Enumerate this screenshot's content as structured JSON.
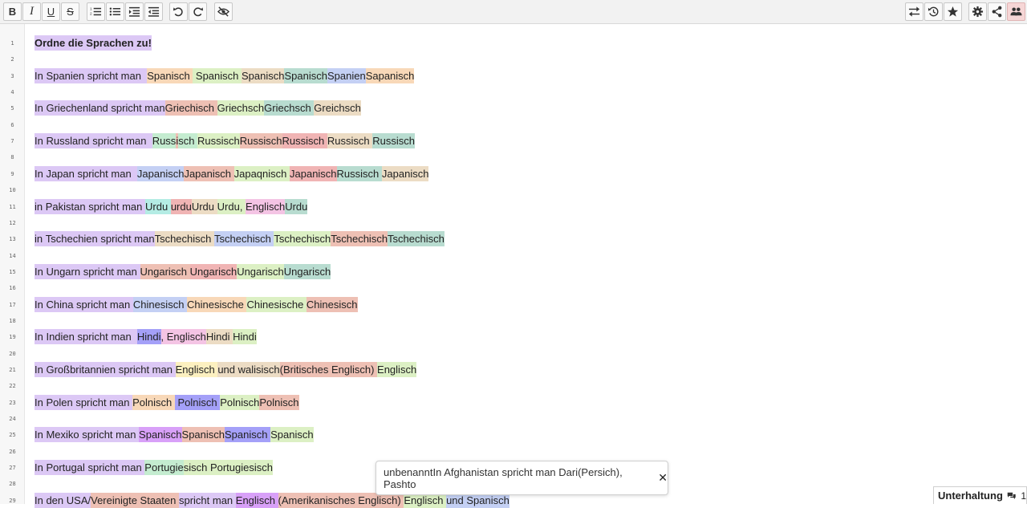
{
  "colors": {
    "lavender": "#dcc8f5",
    "peach": "#f8d8b8",
    "salmon": "#eec0b4",
    "lime": "#dcf0c4",
    "green": "#c4ecd0",
    "teal": "#b8dcd0",
    "cyan": "#b4ece4",
    "blue": "#c4d0f4",
    "rose": "#f0b4b4",
    "pink": "#f4c4e4",
    "tan": "#ecdcc4",
    "purple": "#bca4f8",
    "magenta": "#d8a0f8",
    "yellow": "#fcf0c0",
    "violet": "#a4a0f8"
  },
  "toolbar": {
    "format_buttons": [
      {
        "label": "B",
        "icon": "bold-icon"
      },
      {
        "label": "I",
        "icon": "italic-icon"
      },
      {
        "label": "U",
        "icon": "underline-icon"
      },
      {
        "label": "S",
        "icon": "strikethrough-icon"
      }
    ],
    "list_buttons": [
      "ordered-list-icon",
      "unordered-list-icon",
      "indent-icon",
      "outdent-icon"
    ],
    "history_buttons": [
      "undo-icon",
      "redo-icon"
    ],
    "visibility_button": "eye-off-icon",
    "right_buttons": [
      "import-export-icon",
      "history-icon",
      "star-icon",
      "settings-icon",
      "share-icon",
      "users-icon"
    ]
  },
  "gutter": {
    "numbers": [
      "1",
      "2",
      "3",
      "4",
      "5",
      "6",
      "7",
      "8",
      "9",
      "10",
      "11",
      "12",
      "13",
      "14",
      "15",
      "16",
      "17",
      "18",
      "19",
      "20",
      "21",
      "22",
      "23",
      "24",
      "25",
      "26",
      "27",
      "28",
      "29"
    ]
  },
  "editor": {
    "lines": [
      {
        "row": 1,
        "title": true,
        "segments": [
          {
            "t": "Ordne die Sprachen zu!",
            "c": "lavender"
          }
        ]
      },
      {
        "row": 3,
        "segments": [
          {
            "t": "In Spanien spricht man  ",
            "c": "lavender"
          },
          {
            "t": "Spanisch ",
            "c": "peach"
          },
          {
            "t": " Spanisch ",
            "c": "lime"
          },
          {
            "t": "Spanisch",
            "c": "tan"
          },
          {
            "t": "Spanisch",
            "c": "teal"
          },
          {
            "t": "Spanien",
            "c": "blue"
          },
          {
            "t": "Sapanisch",
            "c": "peach"
          }
        ]
      },
      {
        "row": 5,
        "segments": [
          {
            "t": "In Griechenland spricht man",
            "c": "lavender"
          },
          {
            "t": "Griechisch ",
            "c": "salmon"
          },
          {
            "t": "Griechsch",
            "c": "lime"
          },
          {
            "t": "Griechsch ",
            "c": "teal"
          },
          {
            "t": "Greichsch",
            "c": "tan"
          }
        ]
      },
      {
        "row": 7,
        "segments": [
          {
            "t": "In Russland spricht man  ",
            "c": "lavender"
          },
          {
            "t": "Russ",
            "c": "green"
          },
          {
            "t": "i",
            "c": "salmon"
          },
          {
            "t": "sch ",
            "c": "green"
          },
          {
            "t": "Russisch",
            "c": "lime"
          },
          {
            "t": "Russisch",
            "c": "salmon"
          },
          {
            "t": "Russisch ",
            "c": "rose"
          },
          {
            "t": "Russisch ",
            "c": "tan"
          },
          {
            "t": "Russisch",
            "c": "teal"
          }
        ]
      },
      {
        "row": 9,
        "segments": [
          {
            "t": "In Japan spricht man  ",
            "c": "lavender"
          },
          {
            "t": "Japanisch",
            "c": "blue"
          },
          {
            "t": "Japanisch ",
            "c": "salmon"
          },
          {
            "t": "Japaqnisch ",
            "c": "lime"
          },
          {
            "t": "Japanisch",
            "c": "rose"
          },
          {
            "t": "Russisch ",
            "c": "teal"
          },
          {
            "t": "Japanisch",
            "c": "tan"
          }
        ]
      },
      {
        "row": 11,
        "segments": [
          {
            "t": "in Pakistan spricht man ",
            "c": "lavender"
          },
          {
            "t": "Urdu ",
            "c": "cyan"
          },
          {
            "t": "urdu",
            "c": "rose"
          },
          {
            "t": "Urdu ",
            "c": "tan"
          },
          {
            "t": "Urdu, ",
            "c": "lime"
          },
          {
            "t": "Englisch",
            "c": "pink"
          },
          {
            "t": "Urdu",
            "c": "teal"
          }
        ]
      },
      {
        "row": 13,
        "segments": [
          {
            "t": "in Tschechien spricht man",
            "c": "lavender"
          },
          {
            "t": "Tschechisch ",
            "c": "tan"
          },
          {
            "t": "Tschechisch ",
            "c": "blue"
          },
          {
            "t": "Tschechisch",
            "c": "lime"
          },
          {
            "t": "Tschechisch",
            "c": "salmon"
          },
          {
            "t": "Tschechisch",
            "c": "teal"
          }
        ]
      },
      {
        "row": 15,
        "segments": [
          {
            "t": "In Ungarn spricht man ",
            "c": "lavender"
          },
          {
            "t": "Ungarisch ",
            "c": "salmon"
          },
          {
            "t": "Ungarisch",
            "c": "rose"
          },
          {
            "t": "Ungarisch",
            "c": "lime"
          },
          {
            "t": "Ungarisch",
            "c": "teal"
          }
        ]
      },
      {
        "row": 17,
        "segments": [
          {
            "t": "In China spricht man ",
            "c": "lavender"
          },
          {
            "t": "Chinesisch ",
            "c": "blue"
          },
          {
            "t": "Chinesische ",
            "c": "peach"
          },
          {
            "t": "Chinesische ",
            "c": "lime"
          },
          {
            "t": "Chinesisch",
            "c": "salmon"
          }
        ]
      },
      {
        "row": 19,
        "segments": [
          {
            "t": "In Indien spricht man  ",
            "c": "lavender"
          },
          {
            "t": "Hindi",
            "c": "violet"
          },
          {
            "t": ", Englisch",
            "c": "pink"
          },
          {
            "t": "Hindi ",
            "c": "tan"
          },
          {
            "t": "Hindi",
            "c": "lime"
          }
        ]
      },
      {
        "row": 21,
        "segments": [
          {
            "t": "In Großbritannien spricht man ",
            "c": "lavender"
          },
          {
            "t": "Englisch ",
            "c": "yellow"
          },
          {
            "t": "und walisisch",
            "c": "tan"
          },
          {
            "t": "(Britisches Englisch) ",
            "c": "salmon"
          },
          {
            "t": "Englisch",
            "c": "lime"
          }
        ]
      },
      {
        "row": 23,
        "segments": [
          {
            "t": "In Polen spricht man ",
            "c": "lavender"
          },
          {
            "t": "Polnisch ",
            "c": "peach"
          },
          {
            "t": " Polnisch ",
            "c": "violet"
          },
          {
            "t": "Polnisch",
            "c": "lime"
          },
          {
            "t": "Polnisch",
            "c": "salmon"
          }
        ]
      },
      {
        "row": 25,
        "segments": [
          {
            "t": "In Mexiko spricht man ",
            "c": "lavender"
          },
          {
            "t": "Spanisch",
            "c": "magenta"
          },
          {
            "t": "Spanisch",
            "c": "salmon"
          },
          {
            "t": "Spanisch ",
            "c": "violet"
          },
          {
            "t": "Spanisch",
            "c": "lime"
          }
        ]
      },
      {
        "row": 27,
        "segments": [
          {
            "t": "In Portugal spricht man ",
            "c": "lavender"
          },
          {
            "t": "Portugie",
            "c": "green"
          },
          {
            "t": "sisch ",
            "c": "lime"
          },
          {
            "t": "Portugiesisch",
            "c": "lime"
          }
        ]
      },
      {
        "row": 29,
        "segments": [
          {
            "t": "In den USA/",
            "c": "lavender"
          },
          {
            "t": "Vereinigte Staaten ",
            "c": "salmon"
          },
          {
            "t": "spricht man ",
            "c": "lavender"
          },
          {
            "t": "Englisch ",
            "c": "magenta"
          },
          {
            "t": "(Amerikanisches Englisch) ",
            "c": "salmon"
          },
          {
            "t": "Englisch ",
            "c": "lime"
          },
          {
            "t": "und Spanisch",
            "c": "blue"
          }
        ]
      }
    ]
  },
  "tooltip": {
    "text": "unbenanntIn Afghanistan spricht man Dari(Persich), Pashto",
    "close_label": "✕"
  },
  "chat": {
    "label": "Unterhaltung",
    "count": "1"
  }
}
